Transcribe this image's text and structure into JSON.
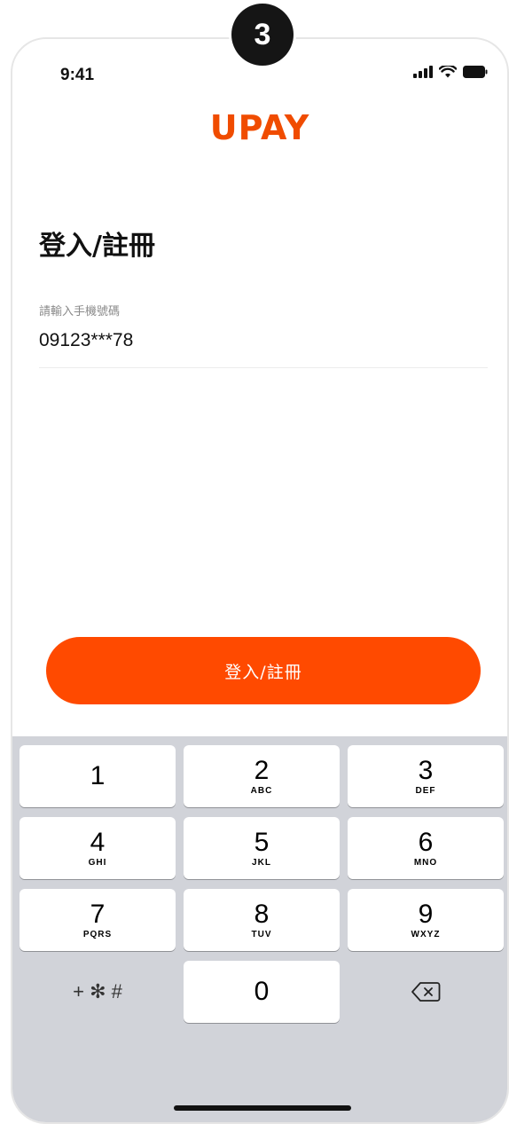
{
  "badge": {
    "step": "3"
  },
  "status_bar": {
    "time": "9:41",
    "icons": [
      "cellular-signal-icon",
      "wifi-icon",
      "battery-icon"
    ]
  },
  "logo": {
    "text": "UPAY",
    "color": "#f04c00"
  },
  "page": {
    "title": "登入/註冊",
    "phone_field": {
      "label": "請輸入手機號碼",
      "value": "09123***78"
    },
    "submit_label": "登入/註冊",
    "accent_color": "#ff4a00"
  },
  "keypad": {
    "keys": [
      {
        "num": "1",
        "letters": ""
      },
      {
        "num": "2",
        "letters": "ABC"
      },
      {
        "num": "3",
        "letters": "DEF"
      },
      {
        "num": "4",
        "letters": "GHI"
      },
      {
        "num": "5",
        "letters": "JKL"
      },
      {
        "num": "6",
        "letters": "MNO"
      },
      {
        "num": "7",
        "letters": "PQRS"
      },
      {
        "num": "8",
        "letters": "TUV"
      },
      {
        "num": "9",
        "letters": "WXYZ"
      },
      {
        "num": "0",
        "letters": ""
      }
    ],
    "symbols": "+ ✻ #",
    "delete_icon": "backspace-icon"
  }
}
